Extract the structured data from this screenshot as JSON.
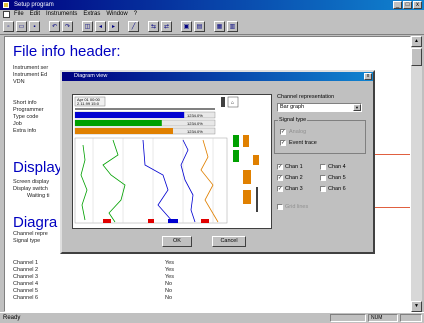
{
  "window": {
    "title": "Setup program",
    "min_label": "_",
    "max_label": "□",
    "close_label": "x"
  },
  "menu": [
    "File",
    "Edit",
    "Instruments",
    "Extras",
    "Window",
    "?"
  ],
  "document": {
    "heading1": "File info header:",
    "info_labels": [
      "Instrument ser",
      "Instrument Ed",
      "VDN",
      "",
      "Short info",
      "Programmer",
      "Type code",
      "Job",
      "Extra info"
    ],
    "heading2": "Display",
    "display_labels": [
      "Screen display",
      "Display switch",
      "Waiting ti"
    ],
    "heading3": "Diagra",
    "diagram_rows": [
      {
        "label": "Channel repre",
        "value": ""
      },
      {
        "label": "Signal type",
        "value": ""
      },
      {
        "label": "Channel 1",
        "value": "Yes"
      },
      {
        "label": "Channel 2",
        "value": "Yes"
      },
      {
        "label": "Channel 3",
        "value": "Yes"
      },
      {
        "label": "Channel 4",
        "value": "No"
      },
      {
        "label": "Channel 5",
        "value": "No"
      },
      {
        "label": "Channel 6",
        "value": "No"
      }
    ]
  },
  "dialog": {
    "title": "Diagram view",
    "representation_label": "Channel representation",
    "representation_value": "Bar graph",
    "signal_group_label": "Signal type",
    "signal_options": [
      {
        "label": "Analog",
        "checked": true
      },
      {
        "label": "Event trace",
        "checked": true
      }
    ],
    "channels": [
      {
        "label": "Chan 1",
        "checked": true
      },
      {
        "label": "Chan 4",
        "checked": false
      },
      {
        "label": "Chan 2",
        "checked": true
      },
      {
        "label": "Chan 5",
        "checked": false
      },
      {
        "label": "Chan 3",
        "checked": true
      },
      {
        "label": "Chan 6",
        "checked": false
      }
    ],
    "extra_option": {
      "label": "Grid lines",
      "checked": false
    },
    "ok_label": "OK",
    "cancel_label": "Cancel",
    "preview": {
      "date_top": "Apr 01 00:00",
      "date_sub": "2.11.99 15:0",
      "bars": [
        {
          "color": "#0000d0",
          "fill": 0.78,
          "value": "1234.0%"
        },
        {
          "color": "#00a000",
          "fill": 0.62,
          "value": "1234.0%"
        },
        {
          "color": "#e08000",
          "fill": 0.7,
          "value": "1234.0%"
        }
      ]
    }
  },
  "status": {
    "text": "Ready",
    "pane2": "NUM"
  }
}
